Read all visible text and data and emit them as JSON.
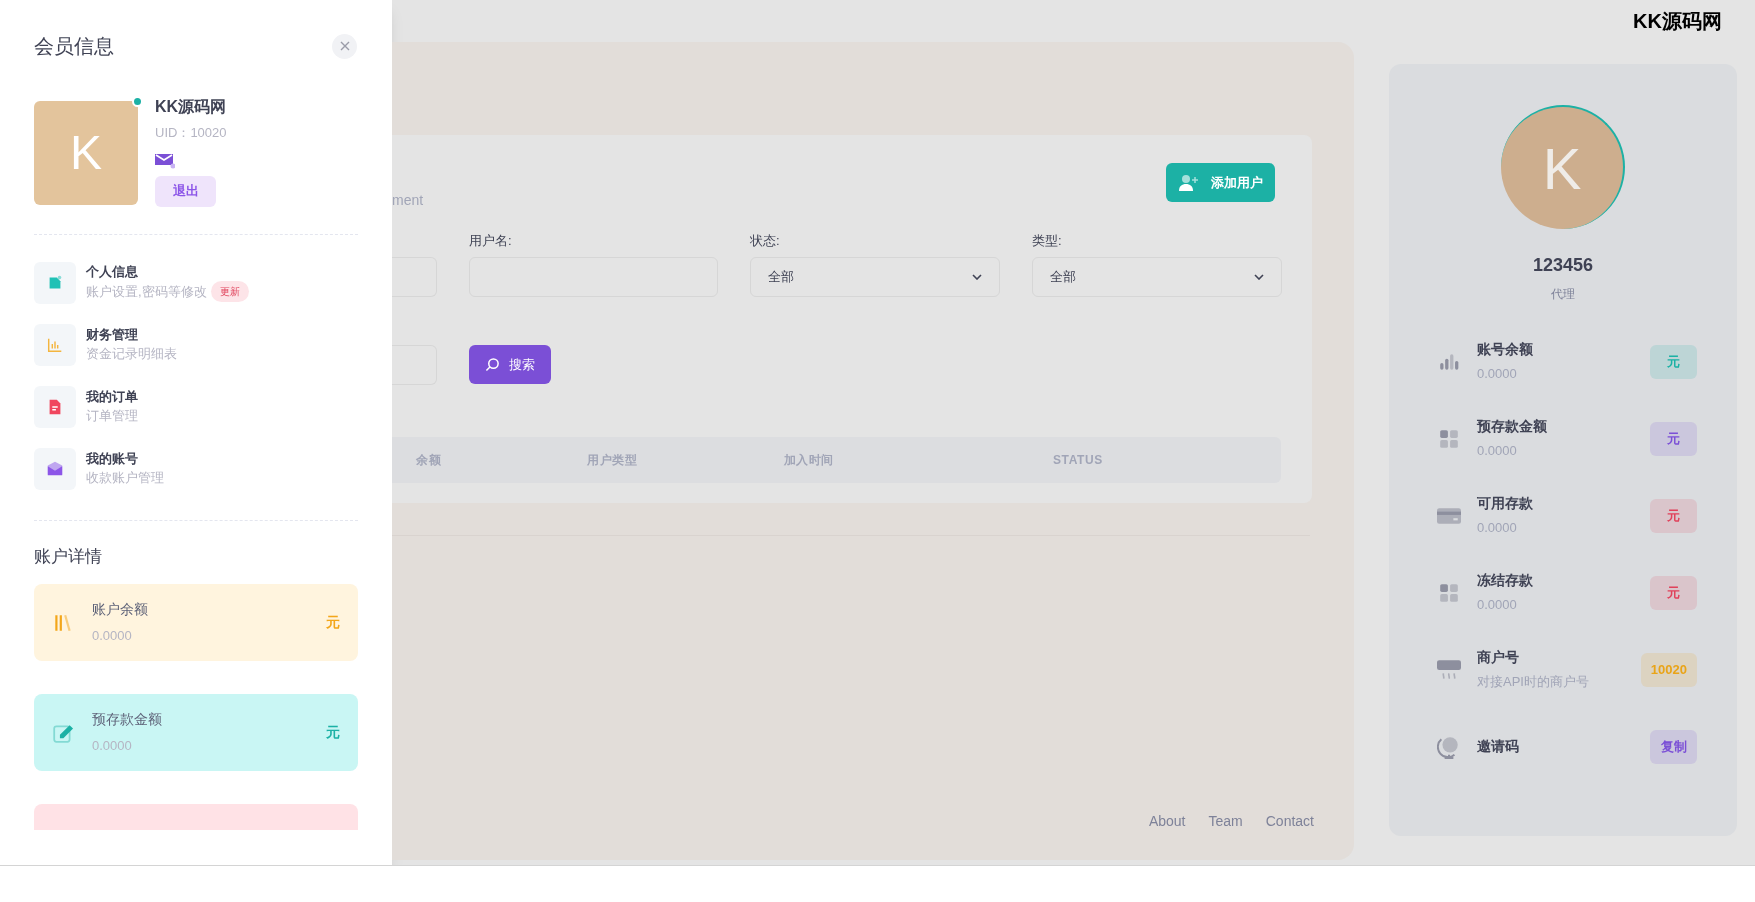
{
  "drawer": {
    "title": "会员信息",
    "profile": {
      "avatar_letter": "K",
      "online": true,
      "name": "KK源码网",
      "uid": "UID：10020",
      "logout": "退出"
    },
    "menu": [
      {
        "title": "个人信息",
        "subtitle": "账户设置,密码等修改",
        "badge": "更新",
        "kind": "doc",
        "color": "#20c1b5"
      },
      {
        "title": "财务管理",
        "subtitle": "资金记录明细表",
        "kind": "chart",
        "color": "#f4b53f"
      },
      {
        "title": "我的订单",
        "subtitle": "订单管理",
        "kind": "file",
        "color": "#f0465e"
      },
      {
        "title": "我的账号",
        "subtitle": "收款账户管理",
        "kind": "mail",
        "color": "#8c55e8"
      }
    ],
    "section_title": "账户详情",
    "account_cards": [
      {
        "label": "账户余额",
        "value": "0.0000",
        "unit": "元",
        "kind": "books",
        "color": "#fff4de"
      },
      {
        "label": "预存款金额",
        "value": "0.0000",
        "unit": "元",
        "kind": "edit",
        "color": "#c9f6f4"
      },
      {
        "color": "#ffe2e6"
      }
    ]
  },
  "logo": "KK源码网",
  "main": {
    "subtitle_fragment": "ment",
    "add_user": "添加用户",
    "filters": [
      {
        "kind": "input"
      },
      {
        "kind": "input",
        "label": "用户名:"
      },
      {
        "kind": "select",
        "label": "状态:",
        "value": "全部"
      },
      {
        "kind": "select",
        "label": "类型:",
        "value": "全部"
      }
    ],
    "second_row": [
      {
        "kind": "input"
      }
    ],
    "search_button": "搜索",
    "table": {
      "columns": [
        "余额",
        "用户类型",
        "加入时间",
        "STATUS"
      ]
    },
    "footer_links": [
      "About",
      "Team",
      "Contact"
    ]
  },
  "profile_panel": {
    "avatar_letter": "K",
    "name": "123456",
    "role": "代理",
    "rows": [
      {
        "label": "账号余额",
        "value": "0.0000",
        "badge": "元",
        "kind": "bars",
        "color": "#1cb1a5"
      },
      {
        "label": "预存款金额",
        "value": "0.0000",
        "badge": "元",
        "kind": "grid",
        "color": "#7b4fd6"
      },
      {
        "label": "可用存款",
        "value": "0.0000",
        "badge": "元",
        "kind": "card",
        "color": "#e0425b"
      },
      {
        "label": "冻结存款",
        "value": "0.0000",
        "badge": "元",
        "kind": "grid",
        "color": "#e0425b"
      },
      {
        "label": "商户号",
        "value": "对接API时的商户号",
        "badge": "10020",
        "kind": "reader",
        "color": "#e9a418"
      },
      {
        "label": "邀请码",
        "badge": "复制",
        "kind": "globe",
        "color": "#7b4fd6"
      }
    ]
  }
}
